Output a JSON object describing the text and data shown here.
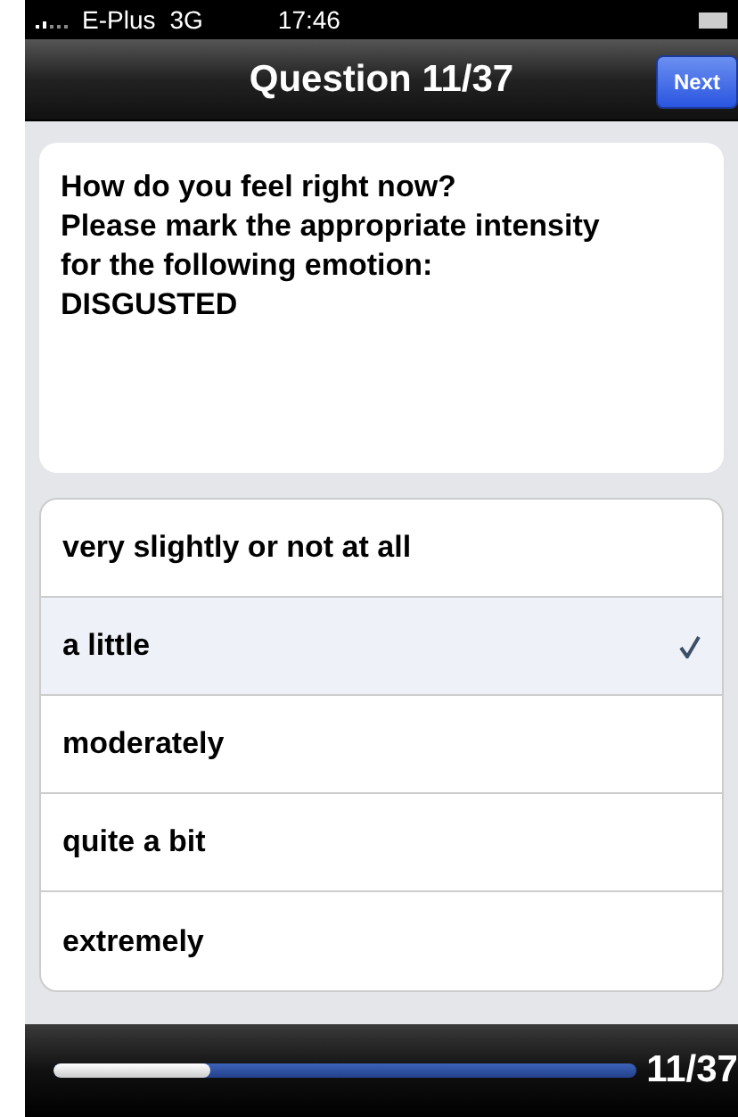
{
  "status_bar": {
    "carrier": "E-Plus",
    "network": "3G",
    "time": "17:46"
  },
  "nav_bar": {
    "title": "Question 11/37",
    "next_button": "Next"
  },
  "question": {
    "lines": [
      "How do you feel right now?",
      "Please mark the appropriate intensity for the following emotion:"
    ],
    "emotion": "DISGUSTED"
  },
  "options": [
    {
      "label": "very slightly or not at all",
      "selected": false
    },
    {
      "label": "a little",
      "selected": true
    },
    {
      "label": "moderately",
      "selected": false
    },
    {
      "label": "quite a bit",
      "selected": false
    },
    {
      "label": "extremely",
      "selected": false
    }
  ],
  "progress": {
    "level": 0.27,
    "reading": "11/37"
  }
}
